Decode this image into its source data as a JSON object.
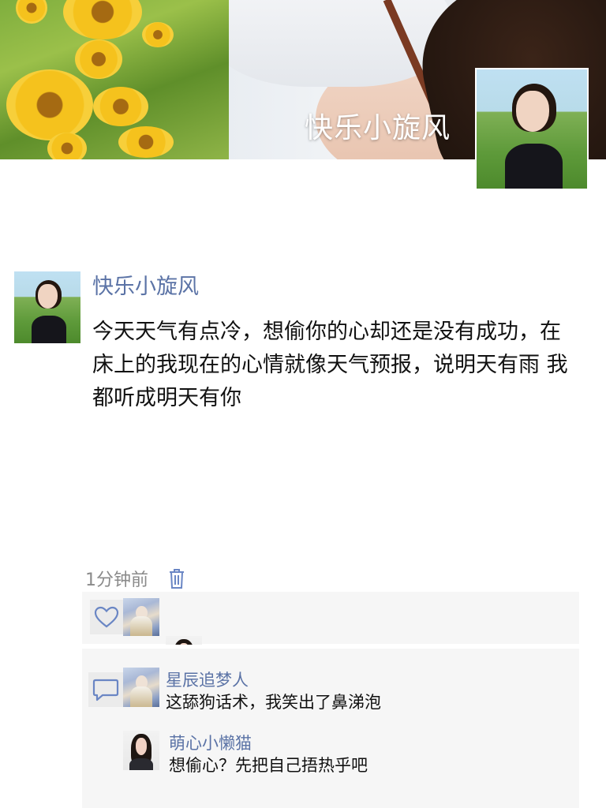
{
  "cover": {
    "name": "快乐小旋风",
    "image": "sunflowers-and-woman-cover",
    "avatar": "woman-in-meadow-avatar"
  },
  "post": {
    "author": "快乐小旋风",
    "avatar": "woman-in-meadow-avatar",
    "text": "今天天气有点冷，想偷你的心却还是没有成功，在床上的我现在的心情就像天气预报，说明天有雨 我都听成明天有你",
    "time": "1分钟前",
    "delete_icon": "trash-icon"
  },
  "likes": {
    "icon": "heart-icon",
    "avatars": [
      "fantasy-girl-avatar",
      "portrait-woman-avatar"
    ]
  },
  "comments": {
    "icon": "comment-bubble-icon",
    "items": [
      {
        "name": "星辰追梦人",
        "text": "这舔狗话术，我笑出了鼻涕泡",
        "avatar": "fantasy-girl-avatar"
      },
      {
        "name": "萌心小懒猫",
        "text": "想偷心？先把自己捂热乎吧",
        "avatar": "portrait-woman-avatar"
      }
    ]
  },
  "colors": {
    "name_link": "#5b73a6",
    "panel_bg": "#f6f6f6",
    "icon_blue": "#6a86c4"
  }
}
